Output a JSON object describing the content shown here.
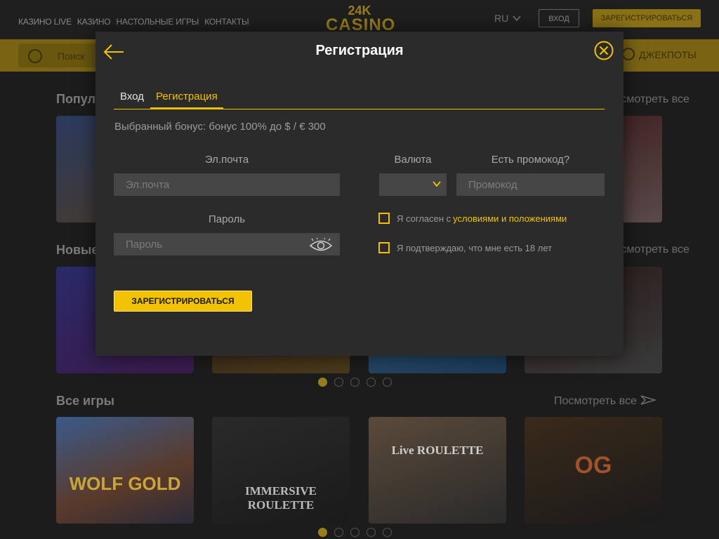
{
  "site": {
    "nav": [
      "КАЗИНО LIVE",
      "КАЗИНО",
      "НАСТОЛЬНЫЕ ИГРЫ",
      "КОНТАКТЫ"
    ],
    "logo_top": "24K",
    "logo_bottom": "CASINO",
    "lang": "RU",
    "login_button": "ВХОД",
    "register_button": "ЗАРЕГИСТРИРОВАТЬСЯ",
    "search_placeholder": "Поиск",
    "jackpots": "ДЖЕКПОТЫ",
    "sections": [
      {
        "title": "Популярные",
        "see_all": "Посмотреть все"
      },
      {
        "title": "Новые",
        "see_all": "Посмотреть все"
      },
      {
        "title": "Все игры",
        "see_all": "Посмотреть все"
      }
    ],
    "tiles": [
      {
        "name": "WOLF GOLD"
      },
      {
        "name": "IMMERSIVE ROULETTE"
      },
      {
        "name": "Live ROULETTE"
      },
      {
        "name": "OG"
      }
    ]
  },
  "modal": {
    "title": "Регистрация",
    "tabs": {
      "login": "Вход",
      "register": "Регистрация"
    },
    "bonus_text": "Выбранный бонус: бонус 100% до $ / € 300",
    "email": {
      "label": "Эл.почта",
      "placeholder": "Эл.почта"
    },
    "password": {
      "label": "Пароль",
      "placeholder": "Пароль"
    },
    "currency": {
      "label": "Валюта",
      "value": ""
    },
    "promo": {
      "label": "Есть промокод?",
      "placeholder": "Промокод"
    },
    "terms": {
      "text": "Я согласен с ",
      "link": "условиями и положениями"
    },
    "age": {
      "text": "Я подтверждаю, что мне есть 18 лет"
    },
    "submit": "ЗАРЕГИСТРИРОВАТЬСЯ"
  },
  "colors": {
    "accent": "#f2c200",
    "modal_bg": "#2b2b2b",
    "input_bg": "#464646"
  }
}
